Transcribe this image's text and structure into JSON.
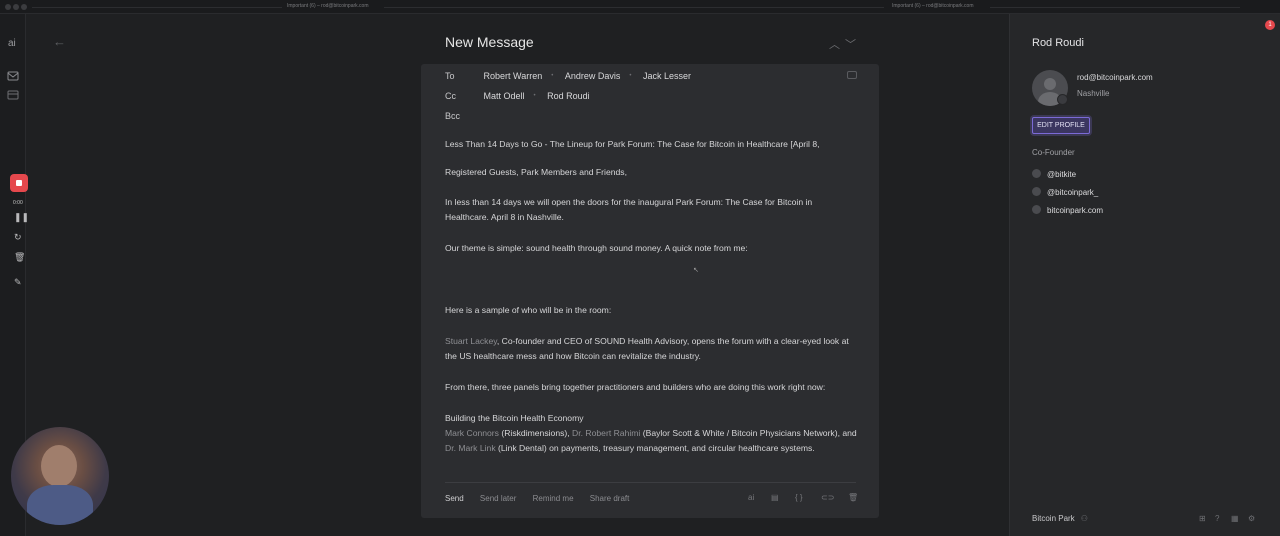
{
  "window": {
    "tab_left": "Important (6) – rod@bitcoinpark.com",
    "tab_right": "Important (6) – rod@bitcoinpark.com"
  },
  "rail": {
    "logo": "ai",
    "recorder_time": "0:00"
  },
  "compose": {
    "title": "New Message",
    "to_label": "To",
    "to": [
      "Robert Warren",
      "Andrew Davis",
      "Jack Lesser"
    ],
    "cc_label": "Cc",
    "cc": [
      "Matt Odell",
      "Rod Roudi"
    ],
    "bcc_label": "Bcc",
    "subject": "Less Than 14 Days to Go - The Lineup for Park Forum: The Case for Bitcoin in Healthcare [April 8,",
    "greeting": "Registered Guests, Park Members and Friends,",
    "para1": "In less than 14 days we will open the doors for the inaugural Park Forum: The Case for Bitcoin in Healthcare. April 8 in Nashville.",
    "para2": "Our theme is simple: sound health through sound money. A quick note from me:",
    "para3": "Here is a sample of who will be in the room:",
    "para4_link": "Stuart Lackey",
    "para4": ", Co-founder and CEO of SOUND Health Advisory, opens the forum with a clear-eyed look at the US healthcare mess and how Bitcoin can revitalize the industry.",
    "para5": "From there, three panels bring together practitioners and builders who are doing this work right now:",
    "panel_title": "Building the Bitcoin Health Economy",
    "p6_link1": "Mark Connors",
    "p6_t1": " (Riskdimensions), ",
    "p6_link2": "Dr. Robert Rahimi",
    "p6_t2": " (Baylor Scott & White / Bitcoin Physicians Network), and ",
    "p6_link3": "Dr. Mark Link",
    "p6_t3": " (Link Dental) on payments, treasury management, and circular healthcare systems.",
    "actions": {
      "send": "Send",
      "send_later": "Send later",
      "remind_me": "Remind me",
      "share_draft": "Share draft",
      "ai": "ai"
    }
  },
  "contact": {
    "name": "Rod Roudi",
    "email": "rod@bitcoinpark.com",
    "location": "Nashville",
    "edit_button": "EDIT PROFILE",
    "role": "Co-Founder",
    "socials": [
      "@bitkite",
      "@bitcoinpark_",
      "bitcoinpark.com"
    ],
    "company": "Bitcoin Park"
  },
  "notification_count": "1",
  "colors": {
    "accent": "#7b6ad6",
    "record": "#e5484d"
  }
}
